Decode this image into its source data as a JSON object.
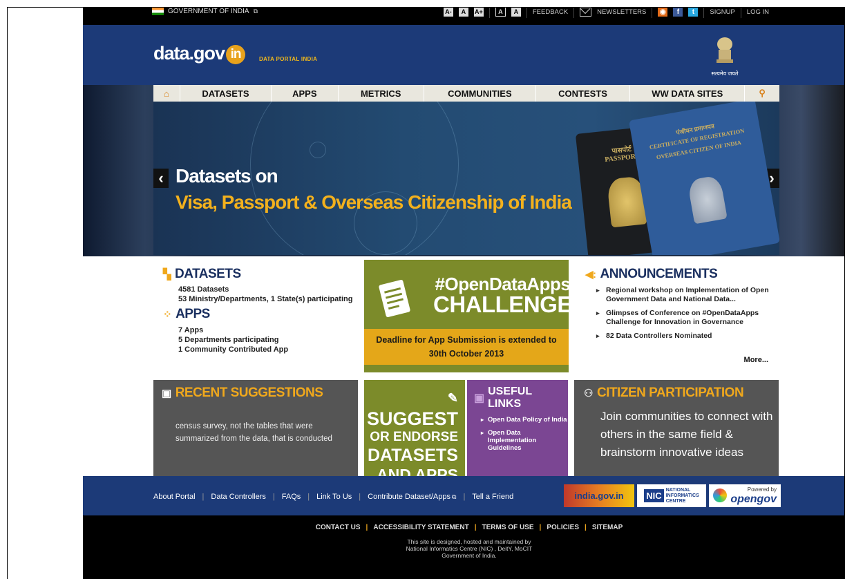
{
  "topbar": {
    "government": "GOVERNMENT OF INDIA",
    "text_sizes": [
      "A-",
      "A",
      "A+"
    ],
    "contrast": [
      "A",
      "A"
    ],
    "feedback": "FEEDBACK",
    "newsletters": "NEWSLETTERS",
    "signup": "SIGNUP",
    "login": "LOG IN"
  },
  "header": {
    "logo_text": "data.gov",
    "logo_badge": "in",
    "tagline": "DATA PORTAL INDIA",
    "emblem_motto": "सत्यमेव जयते"
  },
  "nav": {
    "items": [
      "DATASETS",
      "APPS",
      "METRICS",
      "COMMUNITIES",
      "CONTESTS",
      "WW DATA SITES"
    ]
  },
  "hero": {
    "line1": "Datasets on",
    "line2": "Visa, Passport & Overseas Citizenship of India",
    "passport_left_hindi": "पासपोर्ट",
    "passport_left": "PASSPORT",
    "passport_right_hindi": "पंजीयन प्रमाणपत्र",
    "passport_right": "CERTIFICATE OF REGISTRATION",
    "passport_right_2": "OVERSEAS CITIZEN OF INDIA"
  },
  "datasets_tile": {
    "title": "DATASETS",
    "count": "4581 Datasets",
    "participation": "53 Ministry/Departments, 1 State(s) participating",
    "apps_title": "APPS",
    "apps_count": "7 Apps",
    "apps_departments": "5 Departments participating",
    "apps_community": "1 Community Contributed App"
  },
  "challenge_tile": {
    "line1": "#OpenDataApps",
    "line2": "CHALLENGE",
    "deadline_line1": "Deadline for App Submission is extended to",
    "deadline_line2": "30th October 2013"
  },
  "announcements": {
    "title": "ANNOUNCEMENTS",
    "items": [
      "Regional workshop on Implementation of Open Government Data and National Data...",
      "Glimpses of Conference on #OpenDataApps Challenge for Innovation in Governance",
      "82 Data Controllers Nominated"
    ],
    "more": "More..."
  },
  "recent": {
    "title": "RECENT SUGGESTIONS",
    "text": "census survey, not the tables that were summarized from the data, that is conducted"
  },
  "suggest": {
    "line1": "SUGGEST",
    "line2": "OR ENDORSE",
    "line3": "DATASETS",
    "line4": "AND APPS"
  },
  "useful": {
    "title": "USEFUL LINKS",
    "links": [
      "Open Data Policy of India",
      "Open Data Implementation Guidelines"
    ]
  },
  "citizen": {
    "title": "CITIZEN PARTICIPATION",
    "text": "Join communities to connect with others in the same field & brainstorm innovative ideas"
  },
  "footer_links": [
    "About Portal",
    "Data Controllers",
    "FAQs",
    "Link To Us",
    "Contribute Dataset/Apps",
    "Tell a Friend"
  ],
  "badges": {
    "india": "india.gov.in",
    "nic": "NATIONAL INFORMATICS CENTRE",
    "powered": "Powered by",
    "opengov": "opengov"
  },
  "bottom_links": [
    "CONTACT US",
    "ACCESSIBILITY STATEMENT",
    "TERMS OF USE",
    "POLICIES",
    "SITEMAP"
  ],
  "credit": {
    "line1": "This site is designed, hosted and maintained by",
    "line2": "National Informatics Centre (NIC) , DeitY, MoCIT",
    "line3": "Government of India."
  }
}
